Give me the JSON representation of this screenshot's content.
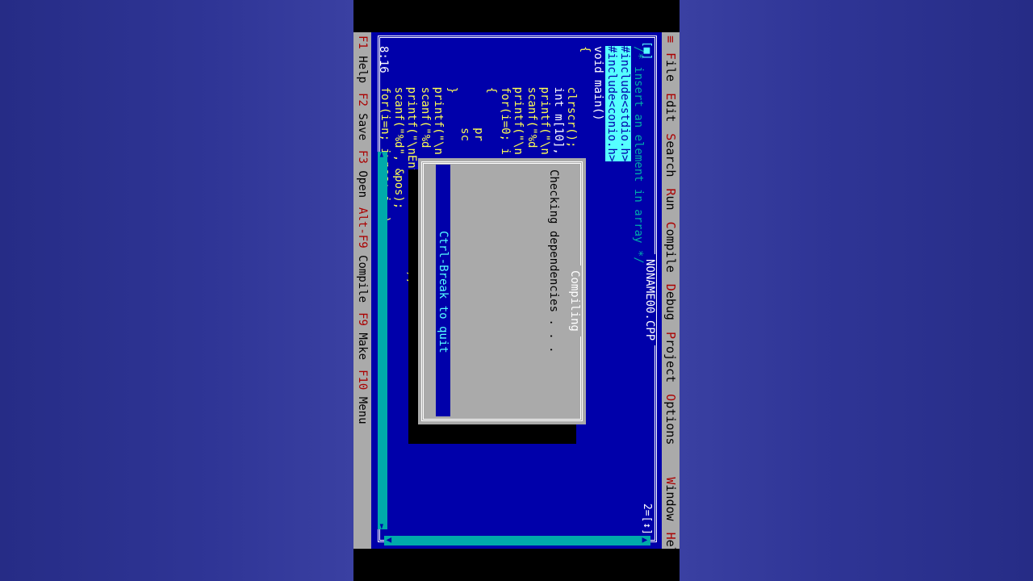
{
  "menu": {
    "system": "≡",
    "items": [
      {
        "hotkey": "F",
        "rest": "ile"
      },
      {
        "hotkey": "E",
        "rest": "dit"
      },
      {
        "hotkey": "S",
        "rest": "earch"
      },
      {
        "hotkey": "R",
        "rest": "un"
      },
      {
        "hotkey": "C",
        "rest": "ompile"
      },
      {
        "hotkey": "D",
        "rest": "ebug"
      },
      {
        "hotkey": "P",
        "rest": "roject"
      },
      {
        "hotkey": "O",
        "rest": "ptions"
      },
      {
        "hotkey": "W",
        "rest": "indow"
      },
      {
        "hotkey": "H",
        "rest": "elp"
      }
    ]
  },
  "window": {
    "title": "NONAME00.CPP",
    "close_box": "[■]",
    "number": "2=[↕]"
  },
  "code": {
    "line1": "/* insert an element in array */",
    "line2": "#include<stdio.h>",
    "line3": "#include<conio.h>",
    "line4": "void main()",
    "line5": "{",
    "line6": "      clrscr();",
    "line7": "      int m[10],",
    "line8": "      printf(\"\\n",
    "line9": "      scanf(\"%d",
    "line10": "      printf(\"\\n",
    "line11": "      for(i=0; i",
    "line12": "      {",
    "line13": "            pr",
    "line14": "            sc",
    "line15": "      }",
    "line16": "      printf(\"\\n",
    "line17": "      scanf(\"%d",
    "line18": "      printf(\"\\nEnter Position: \");",
    "line19": "      scanf(\"%d\", &pos);",
    "line20": "      for(i=n; i>pos; i--)"
  },
  "cursor_pos": "8:16",
  "dialog": {
    "title": "Compiling",
    "message": "Checking dependencies . . .",
    "hint": "Ctrl-Break to quit"
  },
  "status": [
    {
      "key": "F1",
      "label": " Help"
    },
    {
      "key": "F2",
      "label": " Save"
    },
    {
      "key": "F3",
      "label": " Open"
    },
    {
      "key": "Alt-F9",
      "label": " Compile"
    },
    {
      "key": "F9",
      "label": " Make"
    },
    {
      "key": "F10",
      "label": " Menu"
    }
  ],
  "colors": {
    "desktop": "#0000aa",
    "menu_bg": "#aaaaaa",
    "hotkey": "#aa0000",
    "code_text": "#ffff55",
    "comment": "#00aaaa"
  }
}
